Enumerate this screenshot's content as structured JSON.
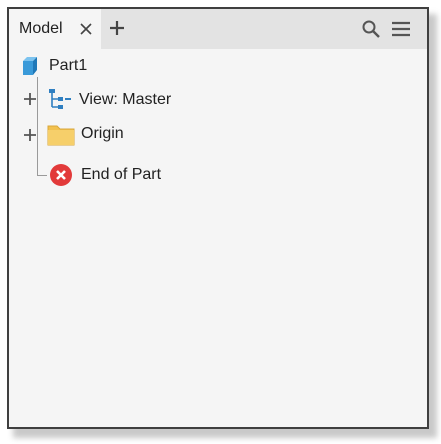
{
  "panel": {
    "tab_label": "Model",
    "tab_close_icon": "close-icon",
    "add_tab_icon": "plus-icon",
    "search_icon": "search-icon",
    "menu_icon": "hamburger-menu-icon"
  },
  "tree": {
    "root": {
      "label": "Part1",
      "icon": "part-cube-icon"
    },
    "nodes": [
      {
        "label": "View: Master",
        "icon": "view-rep-icon",
        "expander": "+"
      },
      {
        "label": "Origin",
        "icon": "folder-icon",
        "expander": "+"
      },
      {
        "label": "End of Part",
        "icon": "end-of-part-icon"
      }
    ]
  },
  "colors": {
    "part_icon": "#3a9ad9",
    "folder_icon": "#f2c14e",
    "end_of_part_icon": "#e23a3a",
    "view_icon": "#2f7fc1"
  }
}
